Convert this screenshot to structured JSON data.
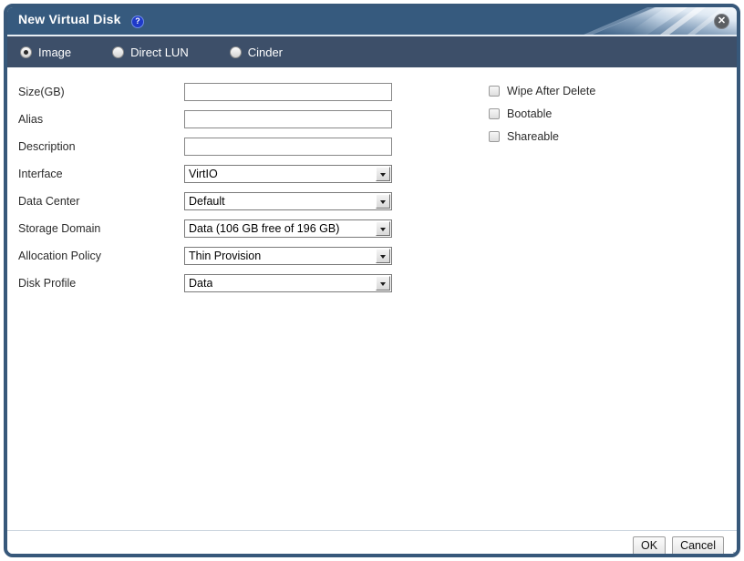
{
  "window": {
    "title": "New Virtual Disk",
    "help_icon": "question-mark-icon",
    "help_glyph": "?",
    "close_icon": "close-icon",
    "close_glyph": "✕",
    "titlebar_color": "#365a7e",
    "border_color": "#37587a"
  },
  "disk_type": {
    "selected": "Image",
    "options": [
      {
        "label": "Image",
        "selected": true
      },
      {
        "label": "Direct LUN",
        "selected": false
      },
      {
        "label": "Cinder",
        "selected": false
      }
    ]
  },
  "form": {
    "fields": [
      {
        "label": "Size(GB)",
        "type": "text",
        "value": "",
        "placeholder": ""
      },
      {
        "label": "Alias",
        "type": "text",
        "value": "",
        "placeholder": ""
      },
      {
        "label": "Description",
        "type": "text",
        "value": "",
        "placeholder": ""
      },
      {
        "label": "Interface",
        "type": "select",
        "value": "VirtIO"
      },
      {
        "label": "Data Center",
        "type": "select",
        "value": "Default"
      },
      {
        "label": "Storage Domain",
        "type": "select",
        "value": "Data (106 GB free of 196 GB)"
      },
      {
        "label": "Allocation Policy",
        "type": "select",
        "value": "Thin Provision"
      },
      {
        "label": "Disk Profile",
        "type": "select",
        "value": "Data"
      }
    ]
  },
  "options": {
    "checkboxes": [
      {
        "label": "Wipe After Delete",
        "checked": false
      },
      {
        "label": "Bootable",
        "checked": false
      },
      {
        "label": "Shareable",
        "checked": false
      }
    ]
  },
  "footer": {
    "ok_label": "OK",
    "cancel_label": "Cancel"
  }
}
